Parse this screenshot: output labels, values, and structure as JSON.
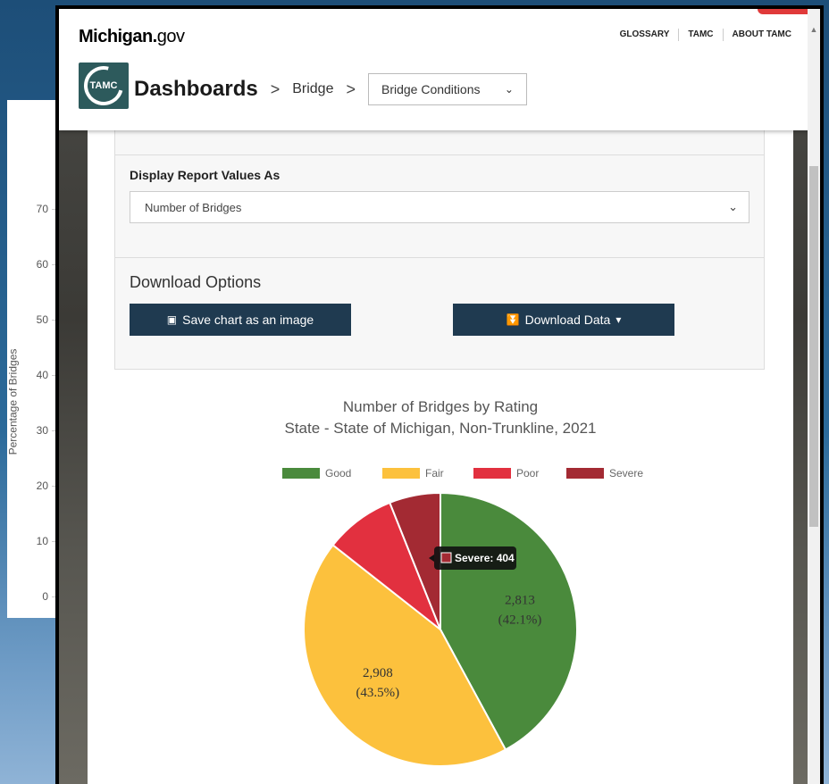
{
  "background_chart": {
    "ylabel": "Percentage of Bridges",
    "ticks": [
      "70",
      "60",
      "50",
      "40",
      "30",
      "20",
      "10",
      "0"
    ]
  },
  "header": {
    "site_logo_bold": "Michigan.",
    "site_logo_gov": "gov",
    "nav": [
      "GLOSSARY",
      "TAMC",
      "ABOUT TAMC"
    ],
    "tamc_logo_text": "TAMC",
    "breadcrumb_main": "Dashboards",
    "breadcrumb_item": "Bridge",
    "breadcrumb_select": "Bridge Conditions",
    "separator": ">"
  },
  "panel": {
    "display_label": "Display Report Values As",
    "display_value": "Number of Bridges",
    "download_title": "Download Options",
    "save_button": "Save chart as an image",
    "download_button": "Download Data"
  },
  "chart_data": {
    "type": "pie",
    "title": "Number of Bridges by Rating",
    "subtitle": "State - State of Michigan, Non-Trunkline, 2021",
    "legend": [
      "Good",
      "Fair",
      "Poor",
      "Severe"
    ],
    "slices": [
      {
        "label": "Good",
        "value": 2813,
        "display": "2,813",
        "percent": "(42.1%)",
        "color": "#4a8a3c"
      },
      {
        "label": "Fair",
        "value": 2908,
        "display": "2,908",
        "percent": "(43.5%)",
        "color": "#fcc13d"
      },
      {
        "label": "Poor",
        "value": 558,
        "color": "#e2303f"
      },
      {
        "label": "Severe",
        "value": 404,
        "color": "#a32a33"
      }
    ],
    "tooltip": "Severe: 404"
  }
}
